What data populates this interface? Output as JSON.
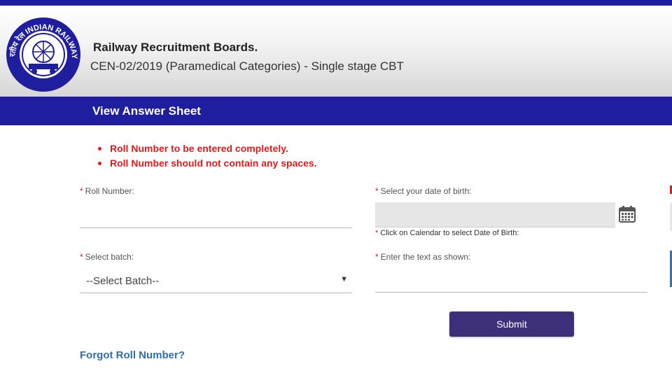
{
  "header": {
    "logo_text": "भारतीय रेल INDIAN RAILWAYS",
    "org_name": "Railway Recruitment Boards.",
    "exam_name": "CEN-02/2019 (Paramedical Categories) - Single stage CBT"
  },
  "title_bar": {
    "title": "View Answer Sheet"
  },
  "notes": [
    "Roll Number to be entered completely.",
    "Roll Number should not contain any spaces."
  ],
  "form": {
    "required_mark": "*",
    "roll_number": {
      "label": "Roll Number:",
      "value": ""
    },
    "dob": {
      "label": "Select your date of birth:",
      "value": "",
      "hint": "Click on Calendar to select Date of Birth:"
    },
    "batch": {
      "label": "Select batch:",
      "selected": "--Select Batch--"
    },
    "captcha": {
      "label": "Enter the text as shown:",
      "value": ""
    },
    "submit_label": "Submit",
    "forgot_label": "Forgot Roll Number?"
  },
  "colors": {
    "brand_blue": "#1e1e9e",
    "error_red": "#e01b1b",
    "submit_purple": "#3e2f7a",
    "link_blue": "#2f6fa8"
  },
  "icons": {
    "calendar": "calendar-icon",
    "dropdown": "chevron-down-icon"
  }
}
